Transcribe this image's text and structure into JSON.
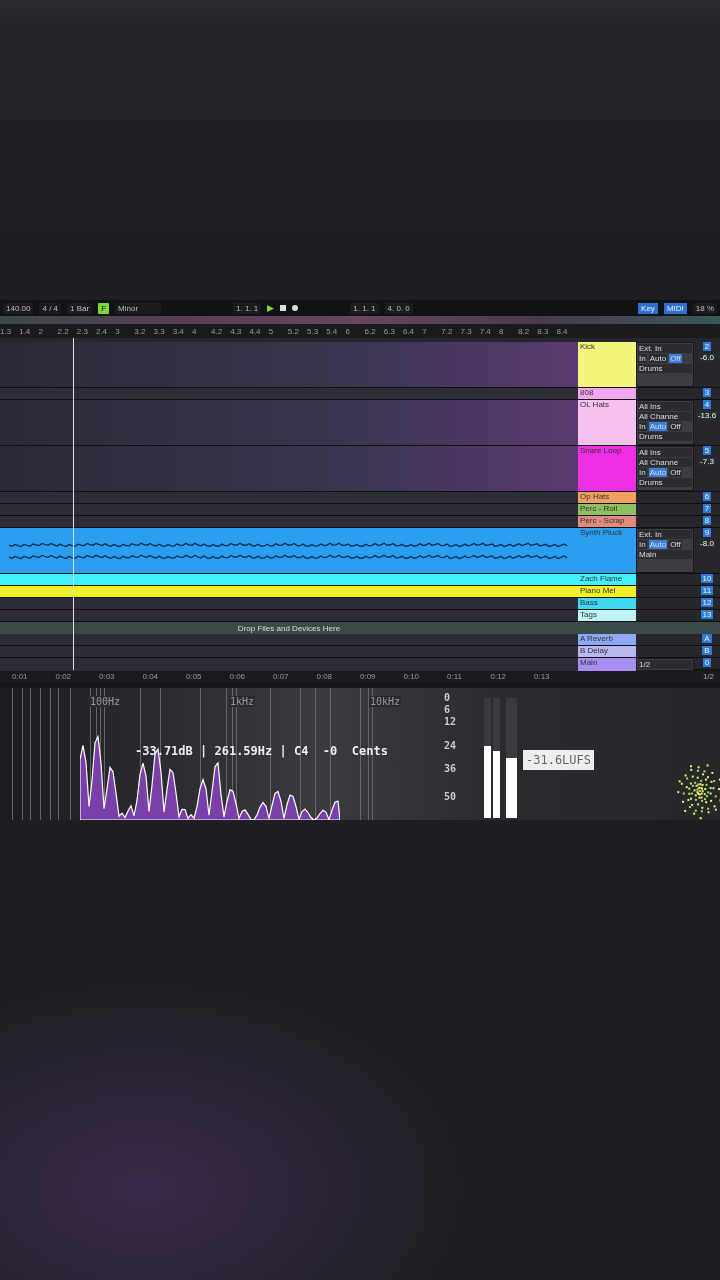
{
  "toolbar": {
    "tempo": "140.00",
    "signature": "4 / 4",
    "quantize": "1 Bar",
    "key": {
      "label": "F",
      "on": true
    },
    "scale": "Minor",
    "position": "1. 1. 1",
    "loop_start": "1. 1. 1",
    "loop_length": "4. 0. 0",
    "key_button": "Key",
    "midi_button": "MIDI",
    "cpu": "18 %"
  },
  "bar_ruler": [
    "1.3",
    "1.4",
    "2",
    "2.2",
    "2.3",
    "2.4",
    "3",
    "3.2",
    "3.3",
    "3.4",
    "4",
    "4.2",
    "4.3",
    "4.4",
    "5",
    "5.2",
    "5.3",
    "5.4",
    "6",
    "6.2",
    "6.3",
    "6.4",
    "7",
    "7.2",
    "7.3",
    "7.4",
    "8",
    "8.2",
    "8.3",
    "8.4"
  ],
  "tracks": [
    {
      "name": "Kick",
      "number": "2",
      "color": "#f5f57c",
      "kind": "expanded",
      "clip": false,
      "input": "Ext. In",
      "output": "Drums",
      "volume": "-6.0",
      "monitor": [
        {
          "label": "In",
          "selected": false
        },
        {
          "label": "Auto",
          "selected": false
        },
        {
          "label": "Off",
          "selected": true
        }
      ]
    },
    {
      "name": "808",
      "number": "3",
      "color": "#f2a6f0",
      "kind": "collapsed",
      "clip": false
    },
    {
      "name": "OL Hats",
      "number": "4",
      "color": "#f5c2ef",
      "kind": "expanded",
      "clip": false,
      "input": "All Ins",
      "channel": "All Channe",
      "output": "Drums",
      "volume": "-13.6",
      "monitor": [
        {
          "label": "In",
          "selected": false
        },
        {
          "label": "Auto",
          "selected": true
        },
        {
          "label": "Off",
          "selected": false
        }
      ]
    },
    {
      "name": "Snare Loop",
      "number": "5",
      "color": "#ee2fe6",
      "kind": "expanded",
      "clip": false,
      "input": "All Ins",
      "channel": "All Channe",
      "output": "Drums",
      "volume": "-7.3",
      "monitor": [
        {
          "label": "In",
          "selected": false
        },
        {
          "label": "Auto",
          "selected": true
        },
        {
          "label": "Off",
          "selected": false
        }
      ]
    },
    {
      "name": "Op Hats",
      "number": "6",
      "color": "#f0a060",
      "kind": "collapsed",
      "clip": false
    },
    {
      "name": "Perc - Roll",
      "number": "7",
      "color": "#8fc060",
      "kind": "collapsed",
      "clip": false
    },
    {
      "name": "Perc - Scrap",
      "number": "8",
      "color": "#e08a80",
      "kind": "collapsed",
      "clip": false
    },
    {
      "name": "Synth Pluck",
      "number": "9",
      "color": "#2c9ef0",
      "kind": "expanded",
      "clip": true,
      "input": "Ext. In",
      "output": "Main",
      "volume": "-8.0",
      "monitor": [
        {
          "label": "In",
          "selected": false
        },
        {
          "label": "Auto",
          "selected": true
        },
        {
          "label": "Off",
          "selected": false
        }
      ]
    },
    {
      "name": "Zach Flame",
      "number": "10",
      "color": "#40f2ff",
      "kind": "collapsed",
      "clip": true
    },
    {
      "name": "Piano Mel",
      "number": "11",
      "color": "#f4f028",
      "kind": "collapsed",
      "clip": true
    },
    {
      "name": "Bass",
      "number": "12",
      "color": "#3fd8f0",
      "kind": "collapsed",
      "clip": false
    },
    {
      "name": "Tags",
      "number": "13",
      "color": "#bff5f5",
      "kind": "collapsed",
      "clip": false
    }
  ],
  "drop_hint": "Drop Files and Devices Here",
  "returns": [
    {
      "name": "A Reverb",
      "number": "A",
      "color": "#8fa8f5"
    },
    {
      "name": "B Delay",
      "number": "B",
      "color": "#b8b8f0"
    },
    {
      "name": "Main",
      "number": "0",
      "color": "#a88ef0"
    }
  ],
  "main_output": "1/2",
  "page_indicator": "1/2",
  "time_ruler": [
    "0:01",
    "0:02",
    "0:03",
    "0:04",
    "0:05",
    "0:06",
    "0:07",
    "0:08",
    "0:09",
    "0:10",
    "0:11",
    "0:12",
    "0:13"
  ],
  "analyzer": {
    "freq_labels": [
      "100Hz",
      "1kHz",
      "10kHz"
    ],
    "readout": "-33.71dB | 261.59Hz | C4  -0  Cents",
    "meter_scale": [
      "0",
      "6",
      "12",
      "24",
      "36",
      "50"
    ],
    "meter_left": {
      "level": 0.6
    },
    "meter_right": {
      "level": 0.56
    },
    "loudness": {
      "level": 0.5
    },
    "lufs": "-31.6LUFS"
  }
}
